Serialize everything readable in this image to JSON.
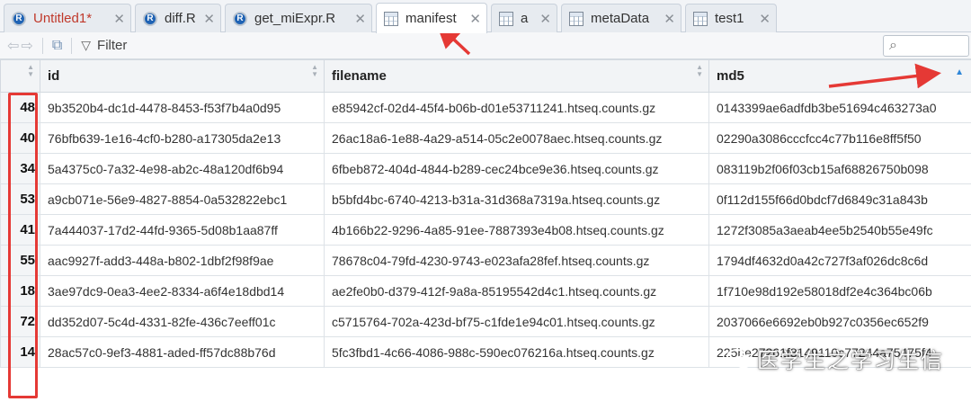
{
  "tabs": [
    {
      "label": "Untitled1*",
      "icon": "r-file-icon",
      "modified": true
    },
    {
      "label": "diff.R",
      "icon": "r-file-icon"
    },
    {
      "label": "get_miExpr.R",
      "icon": "r-file-icon"
    },
    {
      "label": "manifest",
      "icon": "data-grid-icon",
      "active": true
    },
    {
      "label": "a",
      "icon": "data-grid-icon"
    },
    {
      "label": "metaData",
      "icon": "data-grid-icon"
    },
    {
      "label": "test1",
      "icon": "data-grid-icon"
    }
  ],
  "toolbar": {
    "filter_label": "Filter",
    "back_icon": "back-arrow-icon",
    "forward_icon": "forward-arrow-icon",
    "popout_icon": "popout-window-icon",
    "filter_icon": "funnel-icon",
    "search_icon": "magnifier-icon"
  },
  "table": {
    "columns": [
      "id",
      "filename",
      "md5"
    ],
    "sort": {
      "column": "md5",
      "direction": "ascending"
    },
    "rows": [
      {
        "rownum": "48",
        "id": "9b3520b4-dc1d-4478-8453-f53f7b4a0d95",
        "filename": "e85942cf-02d4-45f4-b06b-d01e53711241.htseq.counts.gz",
        "md5": "0143399ae6adfdb3be51694c463273a0"
      },
      {
        "rownum": "40",
        "id": "76bfb639-1e16-4cf0-b280-a17305da2e13",
        "filename": "26ac18a6-1e88-4a29-a514-05c2e0078aec.htseq.counts.gz",
        "md5": "02290a3086cccfcc4c77b116e8ff5f50"
      },
      {
        "rownum": "34",
        "id": "5a4375c0-7a32-4e98-ab2c-48a120df6b94",
        "filename": "6fbeb872-404d-4844-b289-cec24bce9e36.htseq.counts.gz",
        "md5": "083119b2f06f03cb15af68826750b098"
      },
      {
        "rownum": "53",
        "id": "a9cb071e-56e9-4827-8854-0a532822ebc1",
        "filename": "b5bfd4bc-6740-4213-b31a-31d368a7319a.htseq.counts.gz",
        "md5": "0f112d155f66d0bdcf7d6849c31a843b"
      },
      {
        "rownum": "41",
        "id": "7a444037-17d2-44fd-9365-5d08b1aa87ff",
        "filename": "4b166b22-9296-4a85-91ee-7887393e4b08.htseq.counts.gz",
        "md5": "1272f3085a3aeab4ee5b2540b55e49fc"
      },
      {
        "rownum": "55",
        "id": "aac9927f-add3-448a-b802-1dbf2f98f9ae",
        "filename": "78678c04-79fd-4230-9743-e023afa28fef.htseq.counts.gz",
        "md5": "1794df4632d0a42c727f3af026dc8c6d"
      },
      {
        "rownum": "18",
        "id": "3ae97dc9-0ea3-4ee2-8334-a6f4e18dbd14",
        "filename": "ae2fe0b0-d379-412f-9a8a-85195542d4c1.htseq.counts.gz",
        "md5": "1f710e98d192e58018df2e4c364bc06b"
      },
      {
        "rownum": "72",
        "id": "dd352d07-5c4d-4331-82fe-436c7eeff01c",
        "filename": "c5715764-702a-423d-bf75-c1fde1e94c01.htseq.counts.gz",
        "md5": "2037066e6692eb0b927c0356ec652f9"
      },
      {
        "rownum": "14",
        "id": "28ac57c0-9ef3-4881-aded-ff57dc88b76d",
        "filename": "5fc3fbd1-4c66-4086-988c-590ec076216a.htseq.counts.gz",
        "md5": "225be27261f8149110c77244a75475f4"
      }
    ]
  },
  "watermark": {
    "text": "医学生之学习生信"
  },
  "colors": {
    "annotation": "#e53935",
    "sort_active": "#2f87d8",
    "modified_tab": "#c0392b"
  }
}
